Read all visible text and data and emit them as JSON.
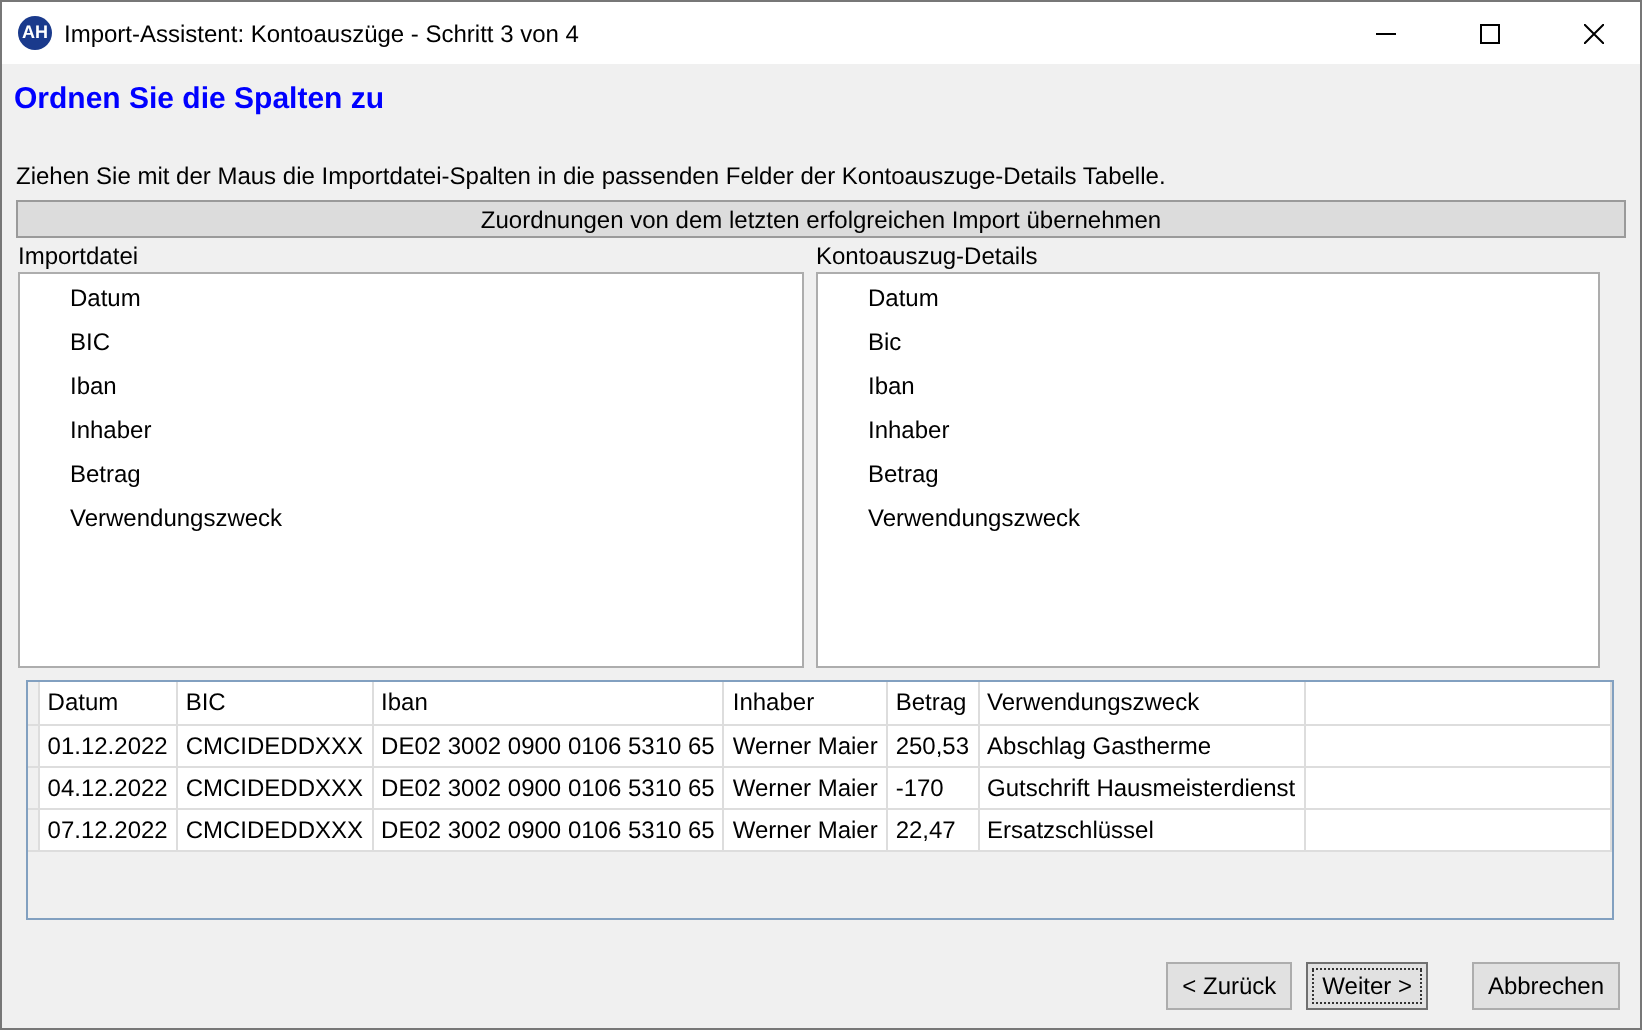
{
  "window": {
    "title": "Import-Assistent: Kontoauszüge - Schritt 3 von 4",
    "logo": "AH"
  },
  "heading": "Ordnen Sie die Spalten zu",
  "instruction": "Ziehen Sie mit der Maus die Importdatei-Spalten in die passenden Felder der Kontoauszuge-Details Tabelle.",
  "reuse_button": "Zuordnungen von dem letzten erfolgreichen Import übernehmen",
  "lists": [
    {
      "label": "Importdatei",
      "items": [
        "Datum",
        "BIC",
        "Iban",
        "Inhaber",
        "Betrag",
        "Verwendungszweck"
      ]
    },
    {
      "label": "Kontoauszug-Details",
      "items": [
        "Datum",
        "Bic",
        "Iban",
        "Inhaber",
        "Betrag",
        "Verwendungszweck"
      ]
    }
  ],
  "table": {
    "columns": [
      "Datum",
      "BIC",
      "Iban",
      "Inhaber",
      "Betrag",
      "Verwendungszweck"
    ],
    "rows": [
      [
        "01.12.2022",
        "CMCIDEDDXXX",
        "DE02 3002 0900 0106 5310 65",
        "Werner Maier",
        "250,53",
        "Abschlag Gastherme"
      ],
      [
        "04.12.2022",
        "CMCIDEDDXXX",
        "DE02 3002 0900 0106 5310 65",
        "Werner Maier",
        "-170",
        "Gutschrift Hausmeisterdienst"
      ],
      [
        "07.12.2022",
        "CMCIDEDDXXX",
        "DE02 3002 0900 0106 5310 65",
        "Werner Maier",
        "22,47",
        "Ersatzschlüssel"
      ]
    ]
  },
  "buttons": [
    {
      "label": "< Zurück",
      "focused": false
    },
    {
      "label": "Weiter >",
      "focused": true
    },
    {
      "label": "Abbrechen",
      "focused": false
    }
  ]
}
